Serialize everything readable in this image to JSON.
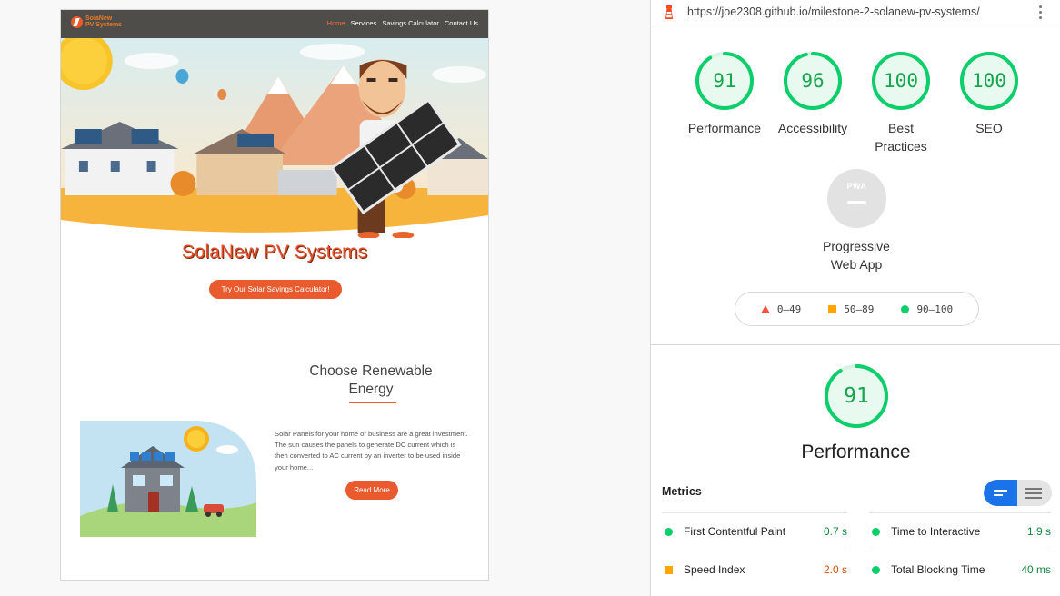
{
  "site": {
    "logo_line1": "SolaNew",
    "logo_line2": "PV Systems",
    "nav": [
      "Home",
      "Services",
      "Savings Calculator",
      "Contact Us"
    ],
    "title": "SolaNew PV Systems",
    "cta_label": "Try Our Solar Savings Calculator!",
    "section_title": "Choose Renewable Energy",
    "section_body": "Solar Panels for your home or business are a great investment. The sun causes the panels to generate DC current which is then converted to AC current by an inverter to be used inside your home...",
    "read_more_label": "Read More"
  },
  "lighthouse": {
    "url": "https://joe2308.github.io/milestone-2-solanew-pv-systems/",
    "scores": [
      {
        "label": "Performance",
        "value": 91
      },
      {
        "label": "Accessibility",
        "value": 96
      },
      {
        "label": "Best Practices",
        "value": 100
      },
      {
        "label": "SEO",
        "value": 100
      }
    ],
    "pwa_badge": "PWA",
    "pwa_label": "Progressive Web App",
    "legend": {
      "fail": "0–49",
      "average": "50–89",
      "pass": "90–100"
    },
    "main_score": 91,
    "main_label": "Performance",
    "metrics_title": "Metrics",
    "metrics": [
      {
        "name": "First Contentful Paint",
        "value": "0.7 s",
        "status": "pass"
      },
      {
        "name": "Time to Interactive",
        "value": "1.9 s",
        "status": "pass"
      },
      {
        "name": "Speed Index",
        "value": "2.0 s",
        "status": "average"
      },
      {
        "name": "Total Blocking Time",
        "value": "40 ms",
        "status": "pass"
      }
    ],
    "colors": {
      "pass": "#0cce6b",
      "average": "#ffa400",
      "fail": "#ff4e42",
      "accent": "#1a73e8"
    }
  }
}
